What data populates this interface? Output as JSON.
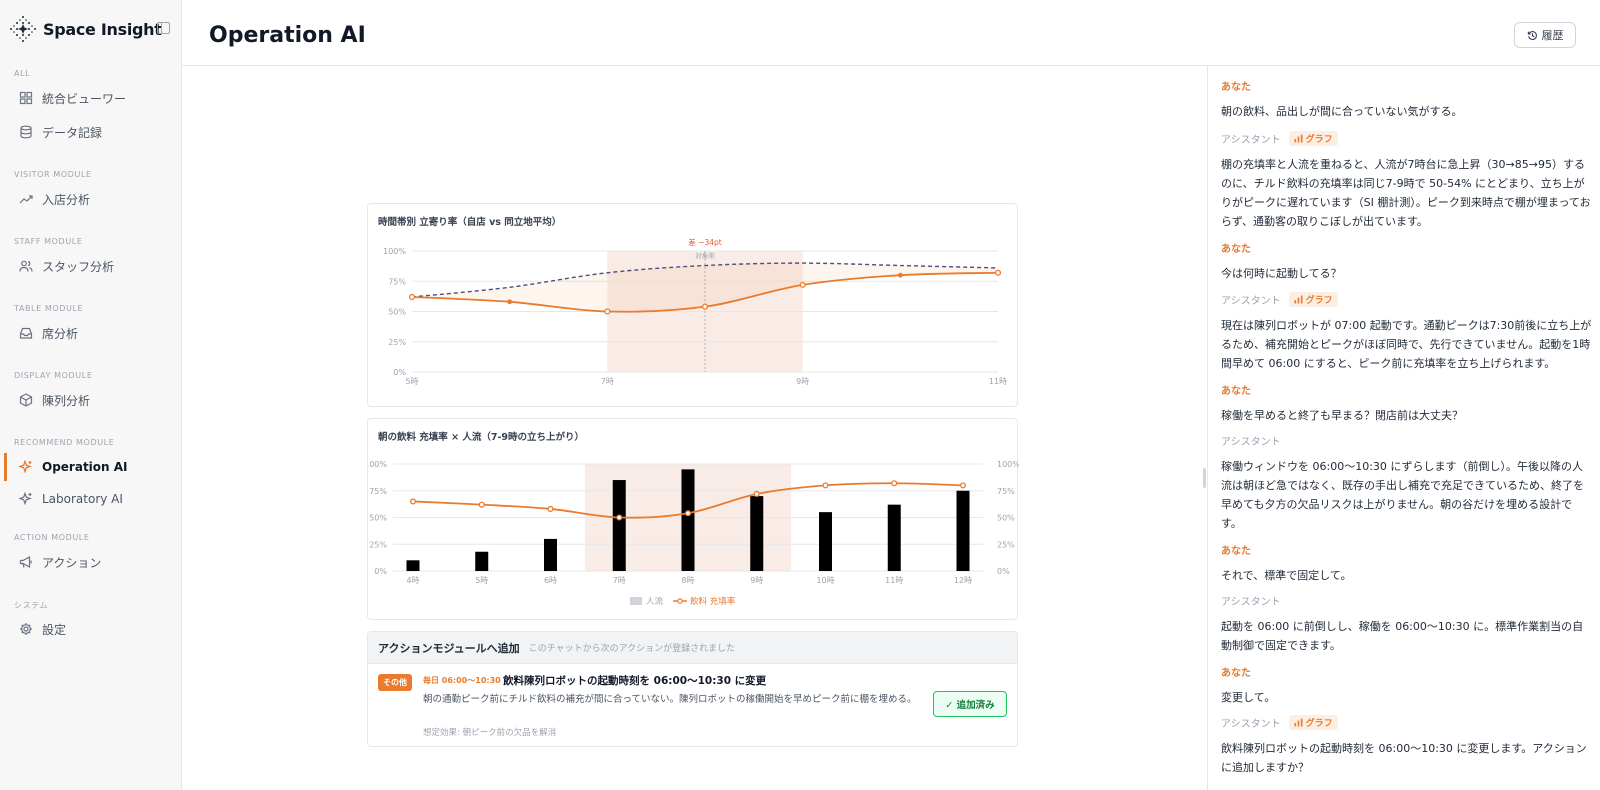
{
  "app": {
    "name": "Space Insight",
    "page_title": "Operation AI",
    "history_label": "履歴"
  },
  "sidebar": {
    "sections": [
      {
        "label": "ALL",
        "items": [
          {
            "label": "統合ビューワー",
            "icon": "grid-icon"
          },
          {
            "label": "データ記録",
            "icon": "database-icon"
          }
        ]
      },
      {
        "label": "VISITOR MODULE",
        "items": [
          {
            "label": "入店分析",
            "icon": "trend-icon"
          }
        ]
      },
      {
        "label": "STAFF MODULE",
        "items": [
          {
            "label": "スタッフ分析",
            "icon": "users-icon"
          }
        ]
      },
      {
        "label": "TABLE MODULE",
        "items": [
          {
            "label": "席分析",
            "icon": "inbox-icon"
          }
        ]
      },
      {
        "label": "DISPLAY MODULE",
        "items": [
          {
            "label": "陳列分析",
            "icon": "box-icon"
          }
        ]
      },
      {
        "label": "RECOMMEND MODULE",
        "items": [
          {
            "label": "Operation AI",
            "icon": "sparkle-icon",
            "active": true
          },
          {
            "label": "Laboratory AI",
            "icon": "sparkle-icon"
          }
        ]
      },
      {
        "label": "ACTION MODULE",
        "items": [
          {
            "label": "アクション",
            "icon": "megaphone-icon"
          }
        ]
      },
      {
        "label": "システム",
        "items": [
          {
            "label": "設定",
            "icon": "gear-icon"
          }
        ]
      }
    ]
  },
  "chart_data": [
    {
      "type": "line",
      "title": "時間帯別 立寄り率（自店 vs 同立地平均）",
      "x_ticks": [
        "5時",
        "7時",
        "9時",
        "11時"
      ],
      "y_ticks": [
        "0%",
        "25%",
        "50%",
        "75%",
        "100%"
      ],
      "ylim": [
        0,
        100
      ],
      "xlim": [
        5,
        11
      ],
      "series": [
        {
          "style": "solid",
          "color": "#ea7a2c",
          "x": [
            5,
            6,
            7,
            8,
            9,
            10,
            11
          ],
          "values": [
            62,
            58,
            50,
            54,
            72,
            80,
            82
          ]
        },
        {
          "style": "dashed",
          "color": "#4b4f7a",
          "x": [
            5,
            6,
            7,
            8,
            9,
            10,
            11
          ],
          "values": [
            62,
            70,
            82,
            88,
            90,
            88,
            86
          ]
        }
      ],
      "highlight_range": [
        7,
        9
      ],
      "highlight_label": "対象帯",
      "annotation": {
        "x": 8,
        "label": "差 −34pt"
      },
      "grid": true
    },
    {
      "type": "bar",
      "title": "朝の飲料 充填率 × 人流（7-9時の立ち上がり）",
      "categories": [
        "4時",
        "5時",
        "6時",
        "7時",
        "8時",
        "9時",
        "10時",
        "11時",
        "12時"
      ],
      "y_ticks": [
        "0%",
        "25%",
        "50%",
        "75%",
        "100%"
      ],
      "ylim": [
        0,
        100
      ],
      "series": [
        {
          "name": "人流",
          "type": "bar",
          "color": "#000000",
          "values": [
            10,
            18,
            30,
            85,
            95,
            70,
            55,
            62,
            75
          ]
        },
        {
          "name": "飲料 充填率",
          "type": "line",
          "color": "#ea7a2c",
          "values": [
            65,
            62,
            58,
            50,
            54,
            72,
            80,
            82,
            80
          ]
        }
      ],
      "highlight_range": [
        "7時",
        "9時"
      ],
      "legend": "bottom",
      "grid": true
    }
  ],
  "action": {
    "header": "アクションモジュールへ追加",
    "header_sub": "このチャットから次のアクションが登録されました",
    "category": "その他",
    "schedule": "毎日 06:00〜10:30",
    "title": "飲料陳列ロボットの起動時刻を 06:00〜10:30 に変更",
    "description": "朝の通勤ピーク前にチルド飲料の補充が間に合っていない。陳列ロボットの稼働開始を早めピーク前に棚を埋める。",
    "effect": "想定効果: 朝ピーク前の欠品を解消",
    "added_label": "✓ 追加済み"
  },
  "chat": {
    "user_label": "あなた",
    "assistant_label": "アシスタント",
    "graph_chip": "グラフ",
    "messages": [
      {
        "role": "user",
        "text": "朝の飲料、品出しが間に合っていない気がする。"
      },
      {
        "role": "assistant",
        "graph": true,
        "text": "棚の充填率と人流を重ねると、人流が7時台に急上昇（30→85→95）するのに、チルド飲料の充填率は同じ7-9時で 50-54% にとどまり、立ち上がりがピークに遅れています（SI 棚計測）。ピーク到来時点で棚が埋まっておらず、通勤客の取りこぼしが出ています。"
      },
      {
        "role": "user",
        "text": "今は何時に起動してる？"
      },
      {
        "role": "assistant",
        "graph": true,
        "text": "現在は陳列ロボットが 07:00 起動です。通勤ピークは7:30前後に立ち上がるため、補充開始とピークがほぼ同時で、先行できていません。起動を1時間早めて 06:00 にすると、ピーク前に充填率を立ち上げられます。"
      },
      {
        "role": "user",
        "text": "稼働を早めると終了も早まる？閉店前は大丈夫？"
      },
      {
        "role": "assistant",
        "graph": false,
        "text": "稼働ウィンドウを 06:00〜10:30 にずらします（前倒し）。午後以降の人流は朝ほど急ではなく、既存の手出し補充で充足できているため、終了を早めても夕方の欠品リスクは上がりません。朝の谷だけを埋める設計です。"
      },
      {
        "role": "user",
        "text": "それで、標準で固定して。"
      },
      {
        "role": "assistant",
        "graph": false,
        "text": "起動を 06:00 に前倒しし、稼働を 06:00〜10:30 に。標準作業割当の自動制御で固定できます。"
      },
      {
        "role": "user",
        "text": "変更して。"
      },
      {
        "role": "assistant",
        "graph": true,
        "text": "飲料陳列ロボットの起動時刻を 06:00〜10:30 に変更します。アクションに追加しますか？"
      }
    ]
  },
  "colors": {
    "accent": "#ea7a2c",
    "dashed_series": "#4b4f7a",
    "success": "#22c55e"
  }
}
